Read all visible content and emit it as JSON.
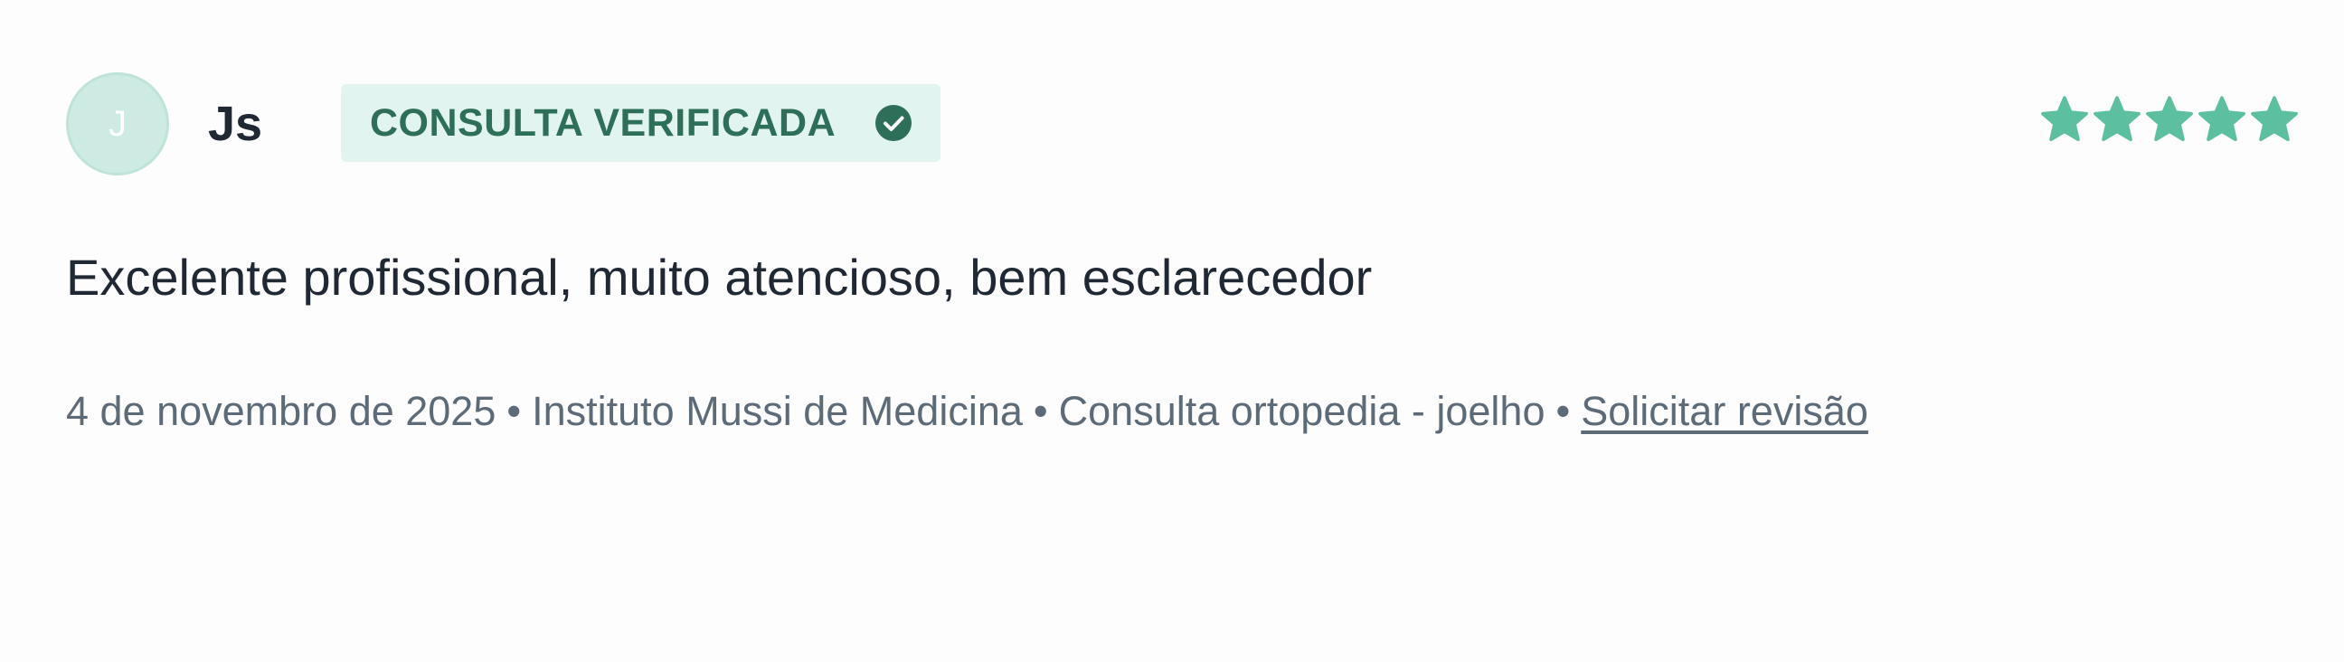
{
  "review": {
    "avatar_initial": "J",
    "author": "Js",
    "badge_label": "CONSULTA VERIFICADA",
    "rating": 5,
    "rating_max": 5,
    "comment": "Excelente profissional, muito atencioso, bem esclarecedor",
    "meta": {
      "date": "4 de novembro de 2025",
      "separator": "•",
      "location": "Instituto Mussi de Medicina",
      "service": "Consulta ortopedia - joelho",
      "revision_link": "Solicitar revisão"
    }
  },
  "colors": {
    "accent": "#5cc0a0",
    "badge_bg": "#e2f4f0",
    "badge_text": "#2e6f5a",
    "text_primary": "#1f2833",
    "text_secondary": "#5d6b79"
  },
  "icons": {
    "badge": "check-circle-icon",
    "rating": "star-icon"
  }
}
